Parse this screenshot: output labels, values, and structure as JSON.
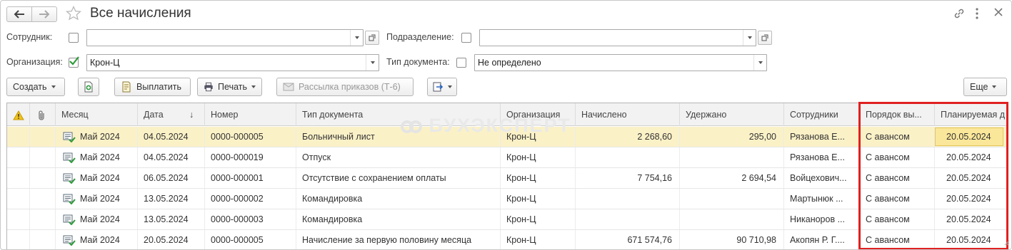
{
  "window": {
    "title": "Все начисления"
  },
  "filters": {
    "employee_label": "Сотрудник:",
    "employee_value": "",
    "department_label": "Подразделение:",
    "department_value": "",
    "organization_label": "Организация:",
    "organization_value": "Крон-Ц",
    "doctype_label": "Тип документа:",
    "doctype_value": "Не определено"
  },
  "toolbar": {
    "create_label": "Создать",
    "pay_label": "Выплатить",
    "print_label": "Печать",
    "mailing_label": "Рассылка приказов (Т-6)",
    "more_label": "Еще"
  },
  "watermark": "БУХЭКСПЕРТ",
  "table": {
    "columns": {
      "month": "Месяц",
      "date": "Дата",
      "number": "Номер",
      "doctype": "Тип документа",
      "organization": "Организация",
      "accrued": "Начислено",
      "withheld": "Удержано",
      "employees": "Сотрудники",
      "payment_order": "Порядок вы...",
      "planned": "Планируемая д"
    },
    "sort_indicator": "↓",
    "rows": [
      {
        "month": "Май 2024",
        "date": "04.05.2024",
        "number": "0000-000005",
        "doctype": "Больничный лист",
        "organization": "Крон-Ц",
        "accrued": "2 268,60",
        "withheld": "295,00",
        "employees": "Рязанова Е...",
        "payment_order": "С авансом",
        "planned": "20.05.2024"
      },
      {
        "month": "Май 2024",
        "date": "04.05.2024",
        "number": "0000-000019",
        "doctype": "Отпуск",
        "organization": "Крон-Ц",
        "accrued": "",
        "withheld": "",
        "employees": "Рязанова Е...",
        "payment_order": "С авансом",
        "planned": "20.05.2024"
      },
      {
        "month": "Май 2024",
        "date": "06.05.2024",
        "number": "0000-000001",
        "doctype": "Отсутствие с сохранением оплаты",
        "organization": "Крон-Ц",
        "accrued": "7 754,16",
        "withheld": "2 694,54",
        "employees": "Войцехович...",
        "payment_order": "С авансом",
        "planned": "20.05.2024"
      },
      {
        "month": "Май 2024",
        "date": "13.05.2024",
        "number": "0000-000002",
        "doctype": "Командировка",
        "organization": "Крон-Ц",
        "accrued": "",
        "withheld": "",
        "employees": "Мартынюк ...",
        "payment_order": "С авансом",
        "planned": "20.05.2024"
      },
      {
        "month": "Май 2024",
        "date": "13.05.2024",
        "number": "0000-000003",
        "doctype": "Командировка",
        "organization": "Крон-Ц",
        "accrued": "",
        "withheld": "",
        "employees": "Никаноров ...",
        "payment_order": "С авансом",
        "planned": "20.05.2024"
      },
      {
        "month": "Май 2024",
        "date": "20.05.2024",
        "number": "0000-000005",
        "doctype": "Начисление за первую половину месяца",
        "organization": "Крон-Ц",
        "accrued": "671 574,76",
        "withheld": "90 710,98",
        "employees": "Акопян Р. Г....",
        "payment_order": "С авансом",
        "planned": "20.05.2024"
      }
    ]
  },
  "colors": {
    "selected_row": "#fbf1c7",
    "selected_cell": "#fbe79a",
    "highlight_frame": "#e02020",
    "check_green": "#2e9b3a"
  }
}
